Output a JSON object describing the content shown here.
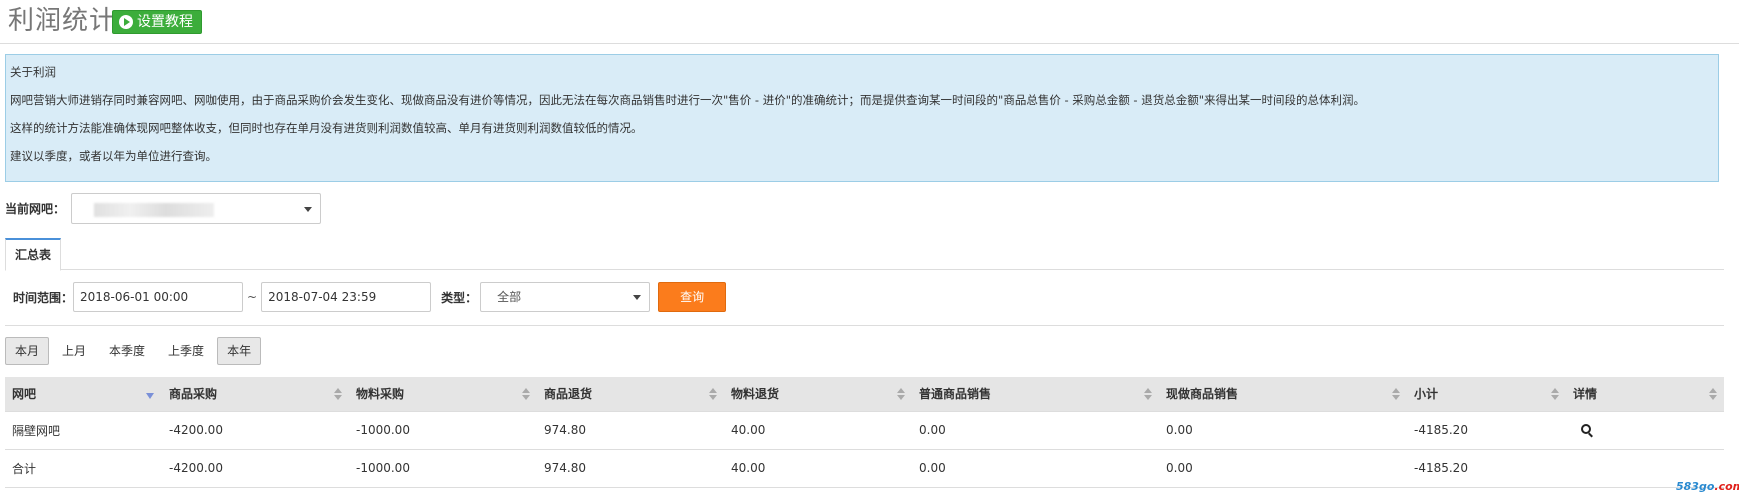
{
  "header": {
    "title": "利润统计",
    "tutorial_button": "设置教程"
  },
  "info": {
    "heading": "关于利润",
    "line1": "网吧营销大师进销存同时兼容网吧、网咖使用，由于商品采购价会发生变化、现做商品没有进价等情况，因此无法在每次商品销售时进行一次\"售价 - 进价\"的准确统计；而是提供查询某一时间段的\"商品总售价 - 采购总金额 - 退货总金额\"来得出某一时间段的总体利润。",
    "line2": "这样的统计方法能准确体现网吧整体收支，但同时也存在单月没有进货则利润数值较高、单月有进货则利润数值较低的情况。",
    "line3": "建议以季度，或者以年为单位进行查询。"
  },
  "cafe": {
    "label": "当前网吧："
  },
  "tabs": {
    "summary": "汇总表"
  },
  "filter": {
    "time_label": "时间范围：",
    "start": "2018-06-01 00:00",
    "separator": "~",
    "end": "2018-07-04 23:59",
    "type_label": "类型：",
    "type_value": "全部",
    "query_button": "查询"
  },
  "periods": [
    "本月",
    "上月",
    "本季度",
    "上季度",
    "本年"
  ],
  "table": {
    "columns": [
      "网吧",
      "商品采购",
      "物料采购",
      "商品退货",
      "物料退货",
      "普通商品销售",
      "现做商品销售",
      "小计",
      "详情"
    ],
    "rows": [
      [
        "隔壁网吧",
        "-4200.00",
        "-1000.00",
        "974.80",
        "40.00",
        "0.00",
        "0.00",
        "-4185.20",
        ""
      ],
      [
        "合计",
        "-4200.00",
        "-1000.00",
        "974.80",
        "40.00",
        "0.00",
        "0.00",
        "-4185.20",
        ""
      ]
    ]
  },
  "watermark": {
    "main": "583go",
    "suffix": ".com"
  },
  "colors": {
    "tutorial_green": "#3cad3b",
    "query_orange": "#fb7c1c",
    "info_bg": "#d9ecf7",
    "negative": "#e0201a",
    "positive": "#2a8a1c"
  }
}
